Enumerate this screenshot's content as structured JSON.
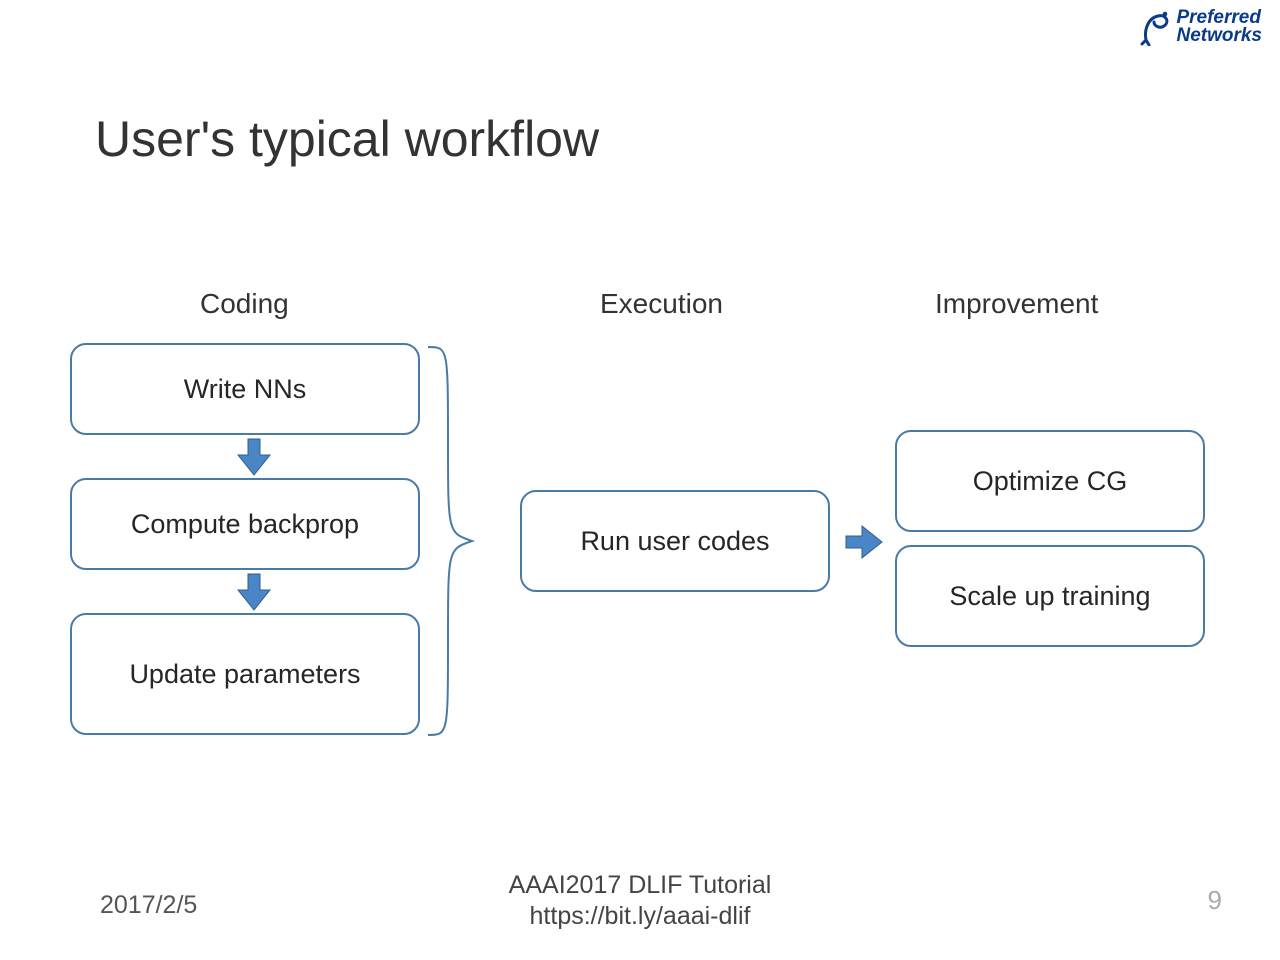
{
  "logo": {
    "line1": "Preferred",
    "line2": "Networks"
  },
  "title": "User's typical workflow",
  "sections": {
    "coding": "Coding",
    "execution": "Execution",
    "improvement": "Improvement"
  },
  "boxes": {
    "write": "Write NNs",
    "compute": "Compute backprop",
    "update": "Update parameters",
    "run": "Run user codes",
    "optimize": "Optimize CG",
    "scale": "Scale up training"
  },
  "footer": {
    "date": "2017/2/5",
    "center_line1": "AAAI2017 DLIF Tutorial",
    "center_line2": "https://bit.ly/aaai-dlif",
    "page": "9"
  },
  "colors": {
    "arrow_fill": "#4a86c5",
    "arrow_stroke": "#2f5e8e",
    "brace": "#4a7ba6",
    "logo": "#0a3b8a"
  }
}
